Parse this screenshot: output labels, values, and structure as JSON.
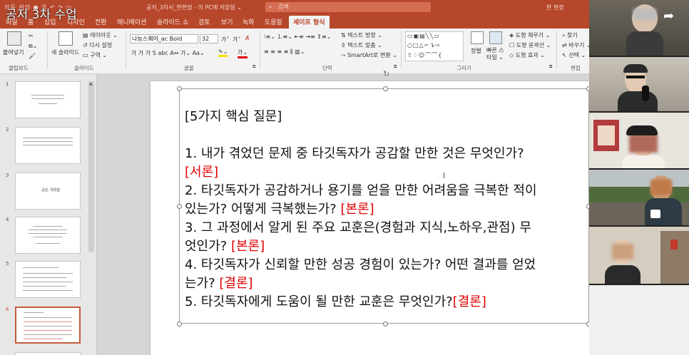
{
  "overlay_title": "공저 3차 수업",
  "titlebar": {
    "qat": "자동 저장 ● 끔 ↶ ↷ ◫",
    "document": "공저_3차시_한현정 - 이 PC에 저장됨 ⌄",
    "search_placeholder": "검색",
    "user": "한 현정"
  },
  "tabs": [
    "파일",
    "홈",
    "삽입",
    "디자인",
    "전환",
    "애니메이션",
    "슬라이드 쇼",
    "검토",
    "보기",
    "녹화",
    "도움말",
    "셰이프 형식"
  ],
  "ribbon": {
    "clipboard": {
      "paste": "붙여넣기",
      "label": "클립보드"
    },
    "slides": {
      "new_slide": "새 슬라이드",
      "layout": "레이아웃 ⌄",
      "reset": "다시 설정",
      "section": "구역 ⌄",
      "label": "슬라이드"
    },
    "font": {
      "name": "나눔스퀘어_ac Bold",
      "size": "32",
      "grow": "가˄",
      "shrink": "가˅",
      "row2": "가  가  가  S  abc  A↔  가⌄  Aa⌄",
      "label": "글꼴"
    },
    "paragraph": {
      "label": "단락",
      "text_direction": "텍스트 방향 ⌄",
      "align_text": "텍스트 맞춤 ⌄",
      "smartart": "SmartArt로 변환 ⌄"
    },
    "drawing": {
      "arrange": "정렬",
      "quick_styles": "빠른 스타일 ⌄",
      "fill": "도형 채우기 ⌄",
      "outline": "도형 윤곽선 ⌄",
      "effects": "도형 효과 ⌄",
      "label": "그리기"
    },
    "editing": {
      "find": "찾기",
      "replace": "바꾸기 ⌄",
      "select": "선택 ⌄",
      "label": "편집"
    }
  },
  "slides": [
    {
      "number": "1"
    },
    {
      "number": "2"
    },
    {
      "number": "3",
      "text": "공감, 위대함"
    },
    {
      "number": "4"
    },
    {
      "number": "5"
    },
    {
      "number": "6"
    }
  ],
  "slide_content": {
    "heading": "[5가지 핵심 질문]",
    "q1": "1. 내가 겪었던 문제 중 타깃독자가 공감할 만한 것은 무엇인가?",
    "q1_tag": "[서론]",
    "q2a": "2. 타깃독자가 공감하거나 용기를 얻을 만한 어려움을 극복한 적이",
    "q2b": "있는가? 어떻게 극복했는가? ",
    "q2_tag": "[본론]",
    "q3a": "3. 그 과정에서 알게 된 주요 교훈은(경험과 지식,노하우,관점) 무",
    "q3b": "엇인가? ",
    "q3_tag": "[본론]",
    "q4a": "4. 타깃독자가 신뢰할 만한 성공 경험이 있는가? 어떤 결과를 얻었",
    "q4b": "는가? ",
    "q4_tag": "[결론]",
    "q5": "5. 타깃독자에게 도움이 될 만한 교훈은 무엇인가?",
    "q5_tag": "[결론]"
  },
  "colors": {
    "accent": "#b7472a",
    "tag_red": "#e00000"
  },
  "icons": [
    "share-icon",
    "search-icon",
    "rotate-handle-icon",
    "text-cursor-icon"
  ]
}
